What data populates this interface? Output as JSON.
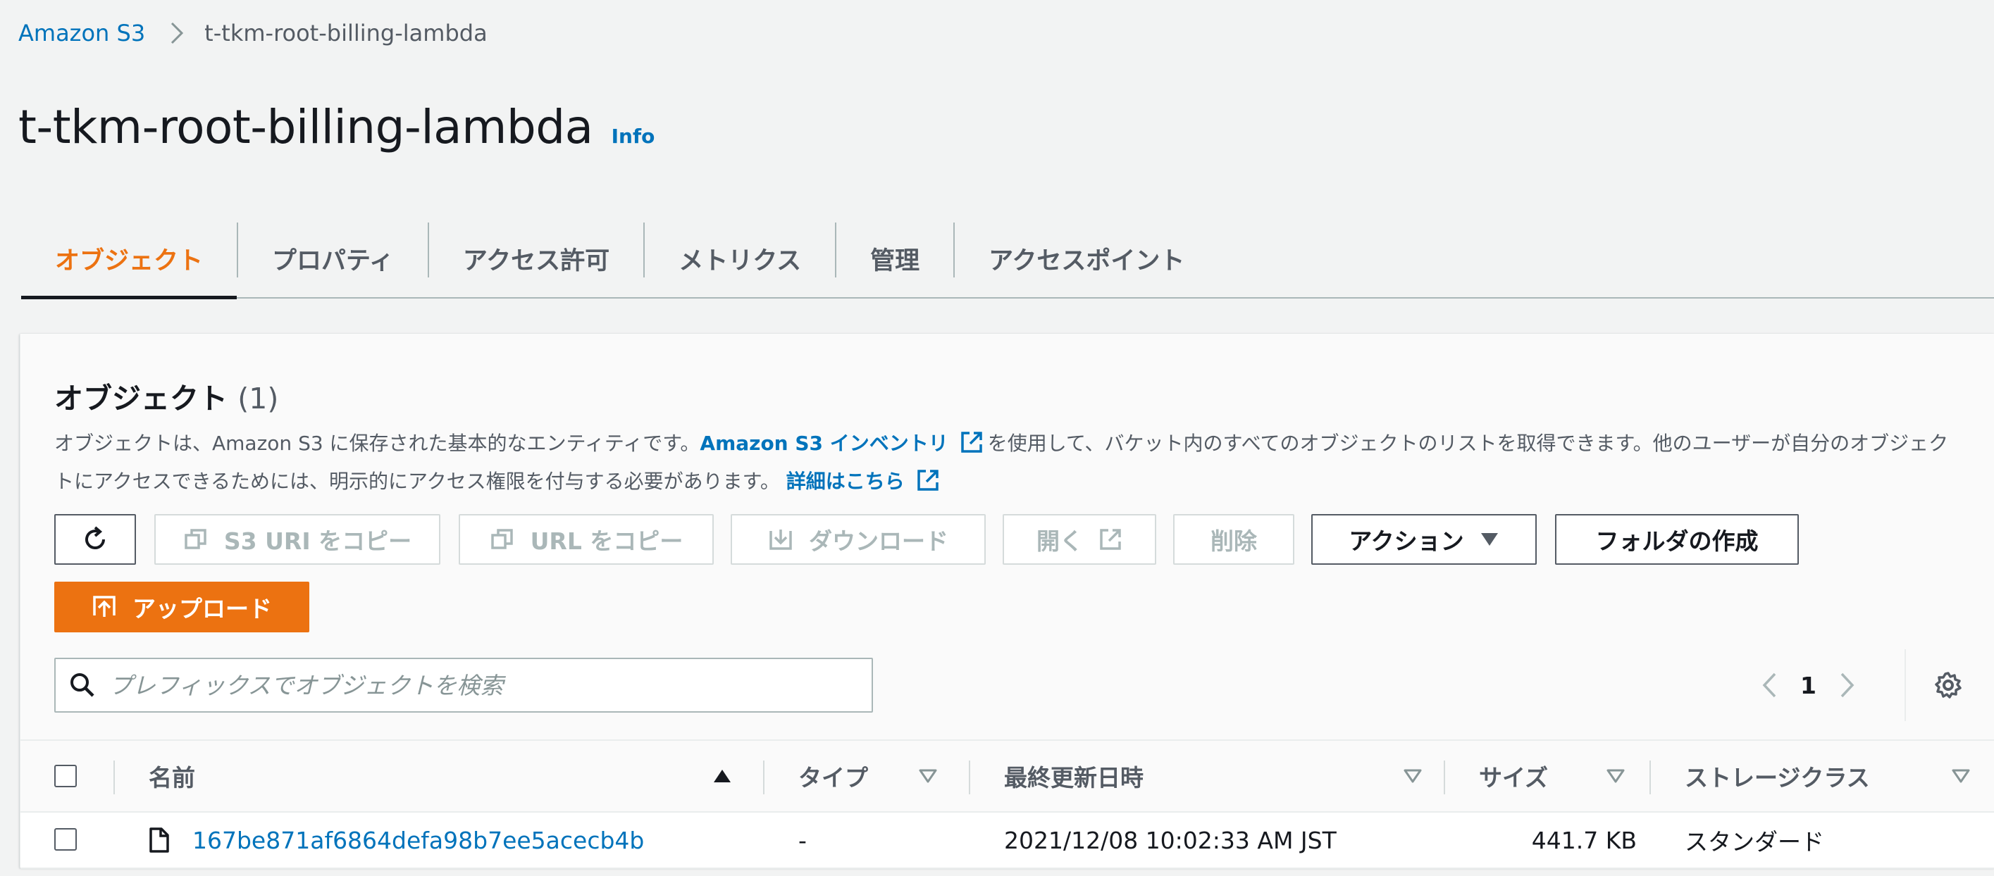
{
  "breadcrumb": {
    "root": "Amazon S3",
    "current": "t-tkm-root-billing-lambda"
  },
  "header": {
    "title": "t-tkm-root-billing-lambda",
    "info": "Info"
  },
  "tabs": [
    {
      "label": "オブジェクト",
      "active": true
    },
    {
      "label": "プロパティ"
    },
    {
      "label": "アクセス許可"
    },
    {
      "label": "メトリクス"
    },
    {
      "label": "管理"
    },
    {
      "label": "アクセスポイント"
    }
  ],
  "objects_panel": {
    "title": "オブジェクト",
    "count": "(1)",
    "description_part1": "オブジェクトは、Amazon S3 に保存された基本的なエンティティです。",
    "inventory_link": "Amazon S3 インベントリ",
    "description_part2": "を使用して、バケット内のすべてのオブジェクトのリストを取得できます。他のユーザーが自分のオブジェクトにアクセスできるためには、明示的にアクセス権限を付与する必要があります。",
    "details_link": "詳細はこちら"
  },
  "toolbar": {
    "copy_s3_uri": "S3 URI をコピー",
    "copy_url": "URL をコピー",
    "download": "ダウンロード",
    "open": "開く",
    "delete": "削除",
    "actions": "アクション",
    "create_folder": "フォルダの作成",
    "upload": "アップロード"
  },
  "search": {
    "placeholder": "プレフィックスでオブジェクトを検索"
  },
  "pagination": {
    "current_page": "1"
  },
  "table": {
    "columns": {
      "name": "名前",
      "type": "タイプ",
      "last_modified": "最終更新日時",
      "size": "サイズ",
      "storage_class": "ストレージクラス"
    },
    "rows": [
      {
        "name": "167be871af6864defa98b7ee5acecb4b",
        "type": "-",
        "last_modified": "2021/12/08 10:02:33 AM JST",
        "size": "441.7 KB",
        "storage_class": "スタンダード"
      }
    ]
  },
  "colors": {
    "accent": "#ec7211",
    "link": "#0073bb",
    "text": "#16191f",
    "muted": "#545b64"
  }
}
